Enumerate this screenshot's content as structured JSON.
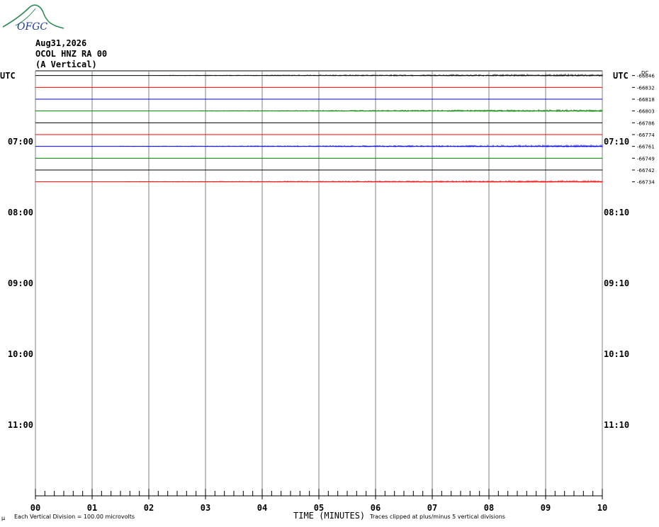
{
  "header": {
    "logo_text": "OFGC",
    "date": "Aug31,2026",
    "station": "OCOL HNZ RA 00",
    "component": "(A Vertical)"
  },
  "footer": {
    "left_note": "Each Vertical Division =  100.00 microvolts",
    "center_label": "TIME (MINUTES)",
    "right_note": "Traces clipped at plus/minus 5 vertical divisions",
    "corner_mark": "μ"
  },
  "colors": {
    "grid": "#808080",
    "trace_cycle": [
      "#000000",
      "#ff0000",
      "#0000ff",
      "#007f00"
    ]
  },
  "chart_data": {
    "type": "line",
    "title": "",
    "xlabel": "TIME (MINUTES)",
    "xlim": [
      0,
      10
    ],
    "x_tick_labels": [
      "00",
      "01",
      "02",
      "03",
      "04",
      "05",
      "06",
      "07",
      "08",
      "09",
      "10"
    ],
    "left_axis_label": "UTC",
    "right_axis_label": "UTC",
    "dc_label": "DC",
    "rows_total": 36,
    "left_time_labels": [
      {
        "row": 6,
        "text": "07:00"
      },
      {
        "row": 12,
        "text": "08:00"
      },
      {
        "row": 18,
        "text": "09:00"
      },
      {
        "row": 24,
        "text": "10:00"
      },
      {
        "row": 30,
        "text": "11:00"
      }
    ],
    "right_time_labels": [
      {
        "row": 6,
        "text": "07:10"
      },
      {
        "row": 12,
        "text": "08:10"
      },
      {
        "row": 18,
        "text": "09:10"
      },
      {
        "row": 24,
        "text": "10:10"
      },
      {
        "row": 30,
        "text": "11:10"
      }
    ],
    "series": [
      {
        "row": 0,
        "dc": "-66846",
        "activity_start": 2.1
      },
      {
        "row": 1,
        "dc": "-66832",
        "activity_start": 10
      },
      {
        "row": 2,
        "dc": "-66818",
        "activity_start": 10
      },
      {
        "row": 3,
        "dc": "-66803",
        "activity_start": 2.9
      },
      {
        "row": 4,
        "dc": "-66786",
        "activity_start": 10
      },
      {
        "row": 5,
        "dc": "-66774",
        "activity_start": 10
      },
      {
        "row": 6,
        "dc": "-66761",
        "activity_start": 1.5
      },
      {
        "row": 7,
        "dc": "-66749",
        "activity_start": 10
      },
      {
        "row": 8,
        "dc": "-66742",
        "activity_start": 10
      },
      {
        "row": 9,
        "dc": "-66734",
        "activity_start": 1.6
      }
    ]
  }
}
